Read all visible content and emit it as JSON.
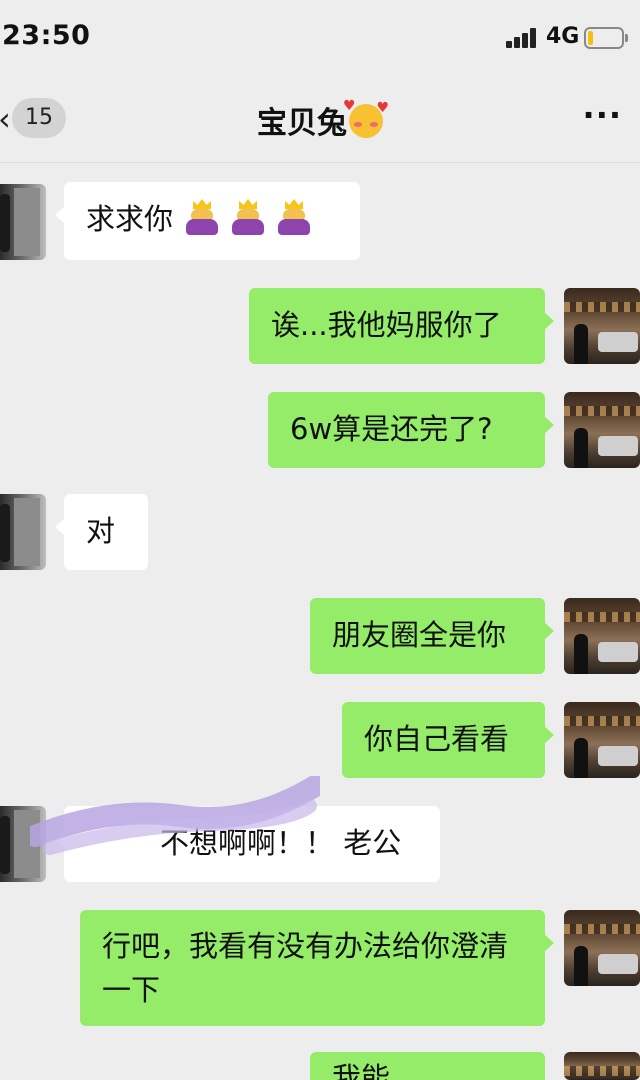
{
  "status_bar": {
    "time": "23:50",
    "network": "4G",
    "battery_level_fraction": 0.15,
    "icons": [
      "signal-icon",
      "battery-icon"
    ]
  },
  "nav": {
    "back_icon": "chevron-left-icon",
    "unread_count": "15",
    "title": "宝贝兔",
    "title_emoji": "smiling-face-with-hearts-icon",
    "more_label": "···"
  },
  "colors": {
    "background": "#ededed",
    "incoming_bubble": "#ffffff",
    "outgoing_bubble": "#95ec69"
  },
  "messages": [
    {
      "side": "in",
      "text": "求求你",
      "emojis": [
        "bowing-woman-icon",
        "bowing-woman-icon",
        "bowing-woman-icon"
      ]
    },
    {
      "side": "out",
      "text": "诶...我他妈服你了"
    },
    {
      "side": "out",
      "text": "6w算是还完了?"
    },
    {
      "side": "in",
      "text": "对"
    },
    {
      "side": "out",
      "text": "朋友圈全是你"
    },
    {
      "side": "out",
      "text": "你自己看看"
    },
    {
      "side": "in",
      "text": "我也不想啊啊!!老公",
      "visible_text": "不想啊啊！！ 老公"
    },
    {
      "side": "out",
      "text": "行吧，我看有没有办法给你澄清一下"
    },
    {
      "side": "out",
      "text": "我能解释明白",
      "visible_text": "我能"
    }
  ]
}
